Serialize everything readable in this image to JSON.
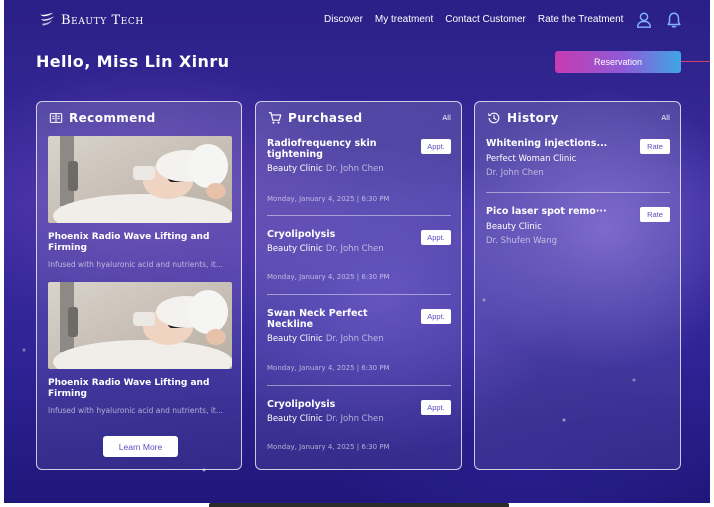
{
  "header": {
    "brand": "Beauty Tech",
    "nav": [
      "Discover",
      "My treatment",
      "Contact Customer",
      "Rate the Treatment"
    ],
    "icons": [
      "user-icon",
      "bell-icon"
    ]
  },
  "greeting": "Hello, Miss Lin Xinru",
  "reservation_label": "Reservation",
  "recommend": {
    "title": "Recommend",
    "cards": [
      {
        "title": "Phoenix Radio Wave Lifting and Firming",
        "desc": "Infused with hyaluronic acid and nutrients, it..."
      },
      {
        "title": "Phoenix Radio Wave Lifting and Firming",
        "desc": "Infused with hyaluronic acid and nutrients, it..."
      }
    ],
    "learn_more": "Learn More"
  },
  "purchased": {
    "title": "Purchased",
    "all": "All",
    "items": [
      {
        "title": "Radiofrequency skin tightening",
        "clinic": "Beauty Clinic",
        "doctor": "Dr. John Chen",
        "date": "Monday, January 4, 2025 | 6:30 PM",
        "button": "Appt."
      },
      {
        "title": "Cryolipolysis",
        "clinic": "Beauty Clinic",
        "doctor": "Dr. John Chen",
        "date": "Monday, January 4, 2025 | 6:30 PM",
        "button": "Appt."
      },
      {
        "title": "Swan Neck Perfect Neckline",
        "clinic": "Beauty Clinic",
        "doctor": "Dr. John Chen",
        "date": "Monday, January 4, 2025 | 6:30 PM",
        "button": "Appt."
      },
      {
        "title": "Cryolipolysis",
        "clinic": "Beauty Clinic",
        "doctor": "Dr. John Chen",
        "date": "Monday, January 4, 2025 | 6:30 PM",
        "button": "Appt."
      }
    ]
  },
  "history": {
    "title": "History",
    "all": "All",
    "items": [
      {
        "title": "Whitening injections...",
        "clinic": "Perfect Woman Clinic",
        "doctor": "Dr. John Chen",
        "button": "Rate"
      },
      {
        "title": "Pico laser spot remo···",
        "clinic": "Beauty Clinic",
        "doctor": "Dr. Shufen Wang",
        "button": "Rate"
      }
    ]
  },
  "colors": {
    "background": "#2f2396",
    "reservation_gradient": [
      "#c73bb0",
      "#8e5bd8",
      "#3fa6e4"
    ],
    "button_text": "#5a4fc0"
  }
}
